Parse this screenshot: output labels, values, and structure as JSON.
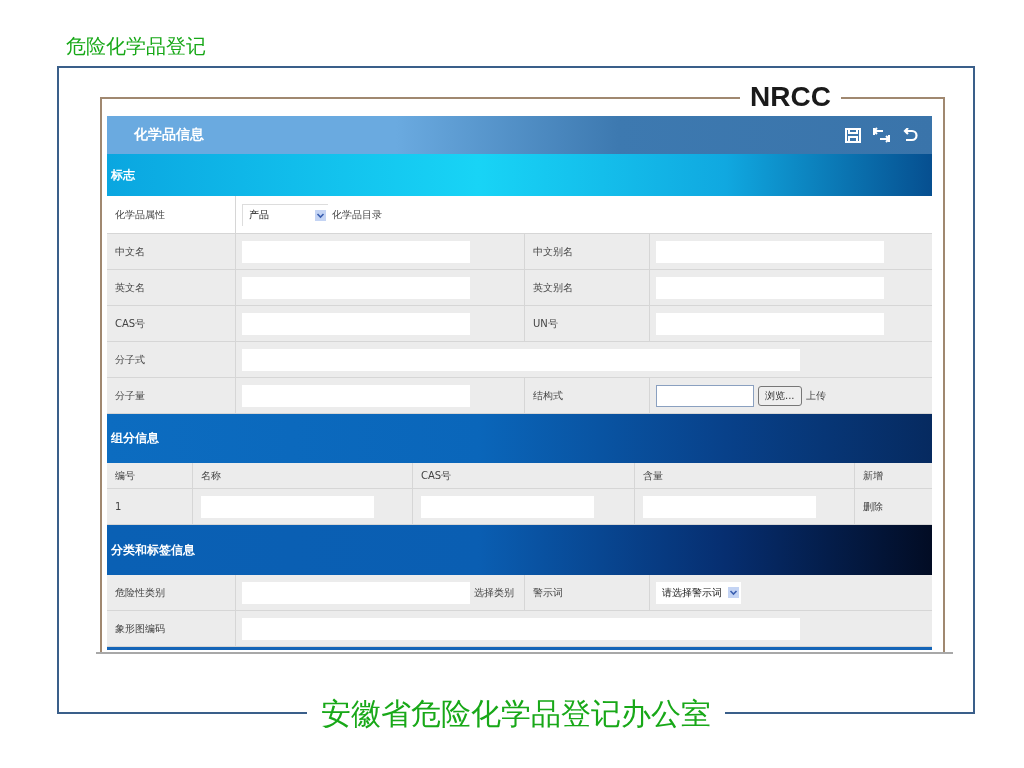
{
  "slide_title": "危险化学品登记",
  "logo": "NRCC",
  "panel": {
    "title": "化学品信息",
    "toolbar": [
      {
        "kind": "save"
      },
      {
        "kind": "swap"
      },
      {
        "kind": "back"
      }
    ]
  },
  "sections": [
    {
      "kind": "form",
      "title": "标志",
      "rows": [
        {
          "label": "化学品属性",
          "field": {
            "kind": "select",
            "value": "产品",
            "after": "化学品目录"
          }
        },
        {
          "label": "中文名",
          "field": {
            "kind": "input"
          },
          "label2": "中文别名",
          "field2": {
            "kind": "input"
          }
        },
        {
          "label": "英文名",
          "field": {
            "kind": "input"
          },
          "label2": "英文别名",
          "field2": {
            "kind": "input"
          }
        },
        {
          "label": "CAS号",
          "field": {
            "kind": "input"
          },
          "label2": "UN号",
          "field2": {
            "kind": "input"
          }
        },
        {
          "label": "分子式",
          "field": {
            "kind": "input"
          }
        },
        {
          "label": "分子量",
          "field": {
            "kind": "input"
          },
          "label2": "结构式",
          "field2": {
            "kind": "file",
            "button": "浏览...",
            "after": "上传"
          }
        }
      ]
    },
    {
      "kind": "table",
      "title": "组分信息",
      "columns": [
        "编号",
        "名称",
        "CAS号",
        "含量",
        "新增"
      ],
      "rows": [
        {
          "number": "1",
          "action": "删除"
        }
      ]
    },
    {
      "kind": "form",
      "title": "分类和标签信息",
      "rows": [
        {
          "label": "危险性类别",
          "field": {
            "kind": "input",
            "after": "选择类别"
          },
          "label2": "警示词",
          "field2": {
            "kind": "select",
            "value": "请选择警示词"
          }
        },
        {
          "label": "象形图编码",
          "field": {
            "kind": "input"
          }
        }
      ]
    }
  ],
  "footer": "安徽省危险化学品登记办公室"
}
